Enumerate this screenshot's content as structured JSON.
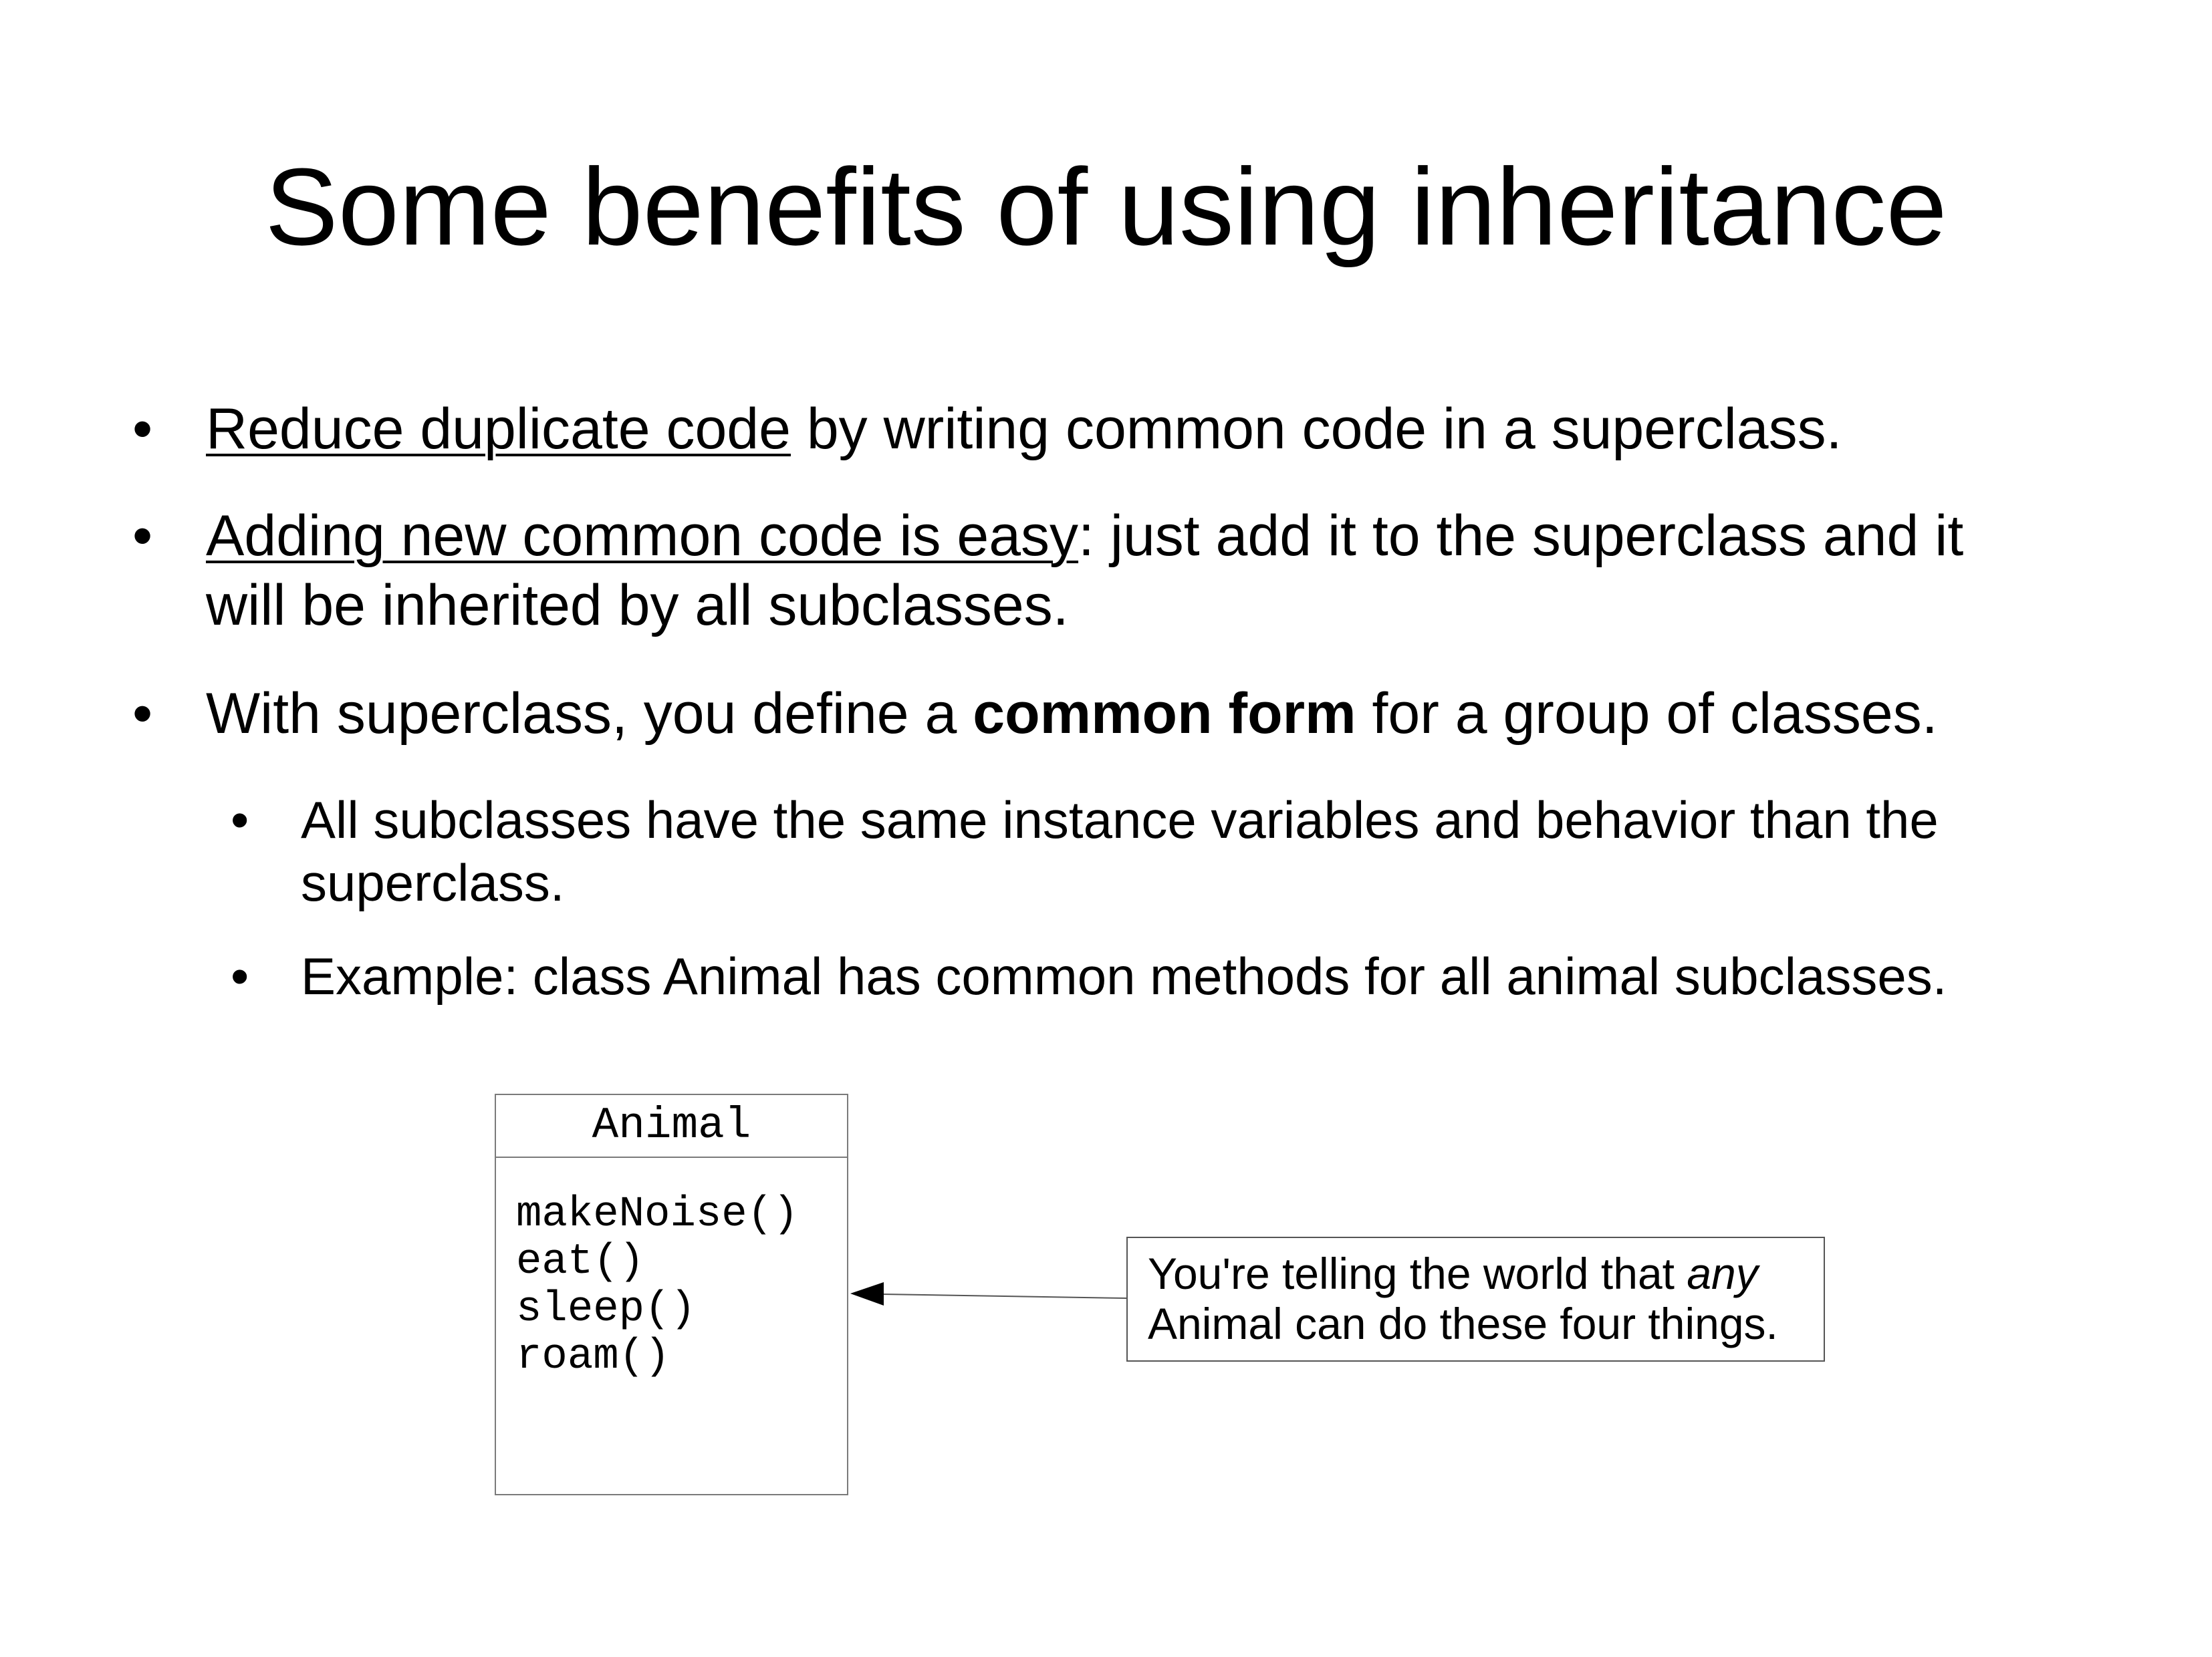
{
  "slide": {
    "title": "Some benefits of using inheritance"
  },
  "bullets": [
    {
      "underlined": "Reduce duplicate code",
      "rest": " by writing common code in a superclass."
    },
    {
      "underlined": "Adding new common code is easy",
      "rest_line1": ": just add it to the superclass and it",
      "rest_line2": "will be inherited by all subclasses."
    },
    {
      "before": "With superclass, you define a ",
      "bold": "common form",
      "after": " for a group of classes."
    }
  ],
  "sub_bullets": [
    {
      "line1": "All subclasses have the same instance variables and behavior than the",
      "line2": "superclass."
    },
    {
      "line1": "Example: class Animal has common methods for all animal subclasses."
    }
  ],
  "bullet_glyph": "•",
  "uml": {
    "class_name": "Animal",
    "methods": [
      "makeNoise()",
      "eat()",
      "sleep()",
      "roam()"
    ]
  },
  "note": {
    "line1_before": "You're telling the world that  ",
    "line1_italic": "any",
    "line2": "Animal can do these four things."
  }
}
